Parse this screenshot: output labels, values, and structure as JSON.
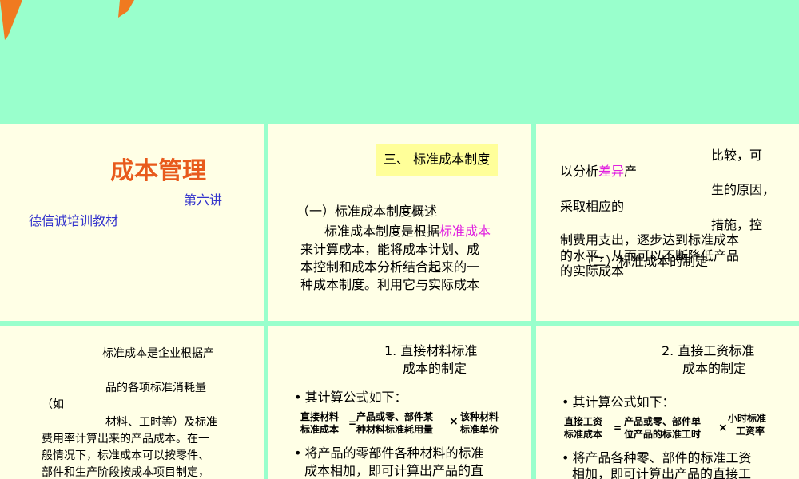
{
  "colors": {
    "background": "#99ffcc",
    "card": "#ffffe6",
    "accent_orange": "#e85a1c",
    "blue": "#3333cc",
    "magenta": "#e020e0",
    "header_box": "#ffff99"
  },
  "slide1": {
    "title": "成本管理",
    "subtitle": "第六讲",
    "org": "德信诚培训教材"
  },
  "slide2": {
    "header": "三、 标准成本制度",
    "section": "（一）标准成本制度概述",
    "line1_pre": "标准成本制度是根据",
    "line1_hl": "标准成本",
    "line2": "来计算成本，能将成本计划、成",
    "line3": "本控制和成本分析结合起来的一",
    "line4": "种成本制度。利用它与实际成本"
  },
  "slide3": {
    "r1": "比较，可",
    "r2_pre": "以分析",
    "r2_hl": "差异",
    "r2_post": "产",
    "r3": "生的原因，",
    "r4": "采取相应的",
    "r5": "措施，控",
    "r6": "制费用支出，逐步达到标准成本",
    "r7a": "的水平，从而可以不断降低产品",
    "r7b": "（二）标准成本的制定",
    "r8": "的实际成本"
  },
  "slide4": {
    "l1": "标准成本是企业根据产",
    "l2": "品的各项标准消耗量",
    "l3": "（如",
    "l4": "材料、工时等）及标准",
    "l5": "费用率计算出来的产品成本。在一",
    "l6": "般情况下，标准成本可以按零件、",
    "l7": "部件和生产阶段按成本项目制定，"
  },
  "slide5": {
    "head1": "1. 直接材料标准",
    "head2": "成本的制定",
    "bullet1": "其计算公式如下：",
    "f_left1": "直接材料",
    "f_left2": "标准成本",
    "f_eq": "=",
    "f_mid1": "产品或零、部件某",
    "f_mid2": "种材料标准耗用量",
    "f_x": "×",
    "f_right1": "该种材料",
    "f_right2": "标准单价",
    "bullet2a": "将产品的零部件各种材料的标准",
    "bullet2b": "成本相加，即可计算出产品的直"
  },
  "slide6": {
    "head1": "2. 直接工资标准",
    "head2": "成本的制定",
    "bullet1": "其计算公式如下：",
    "f_left1": "直接工资",
    "f_left2": "标准成本",
    "f_eq": "=",
    "f_mid1": "产品或零、部件单",
    "f_mid2": "位产品的标准工时",
    "f_x": "×",
    "f_right1": "小时标准",
    "f_right2": "工资率",
    "bullet2a": "将产品各种零、部件的标准工资",
    "bullet2b": "相加，即可计算出产品的直接工"
  }
}
